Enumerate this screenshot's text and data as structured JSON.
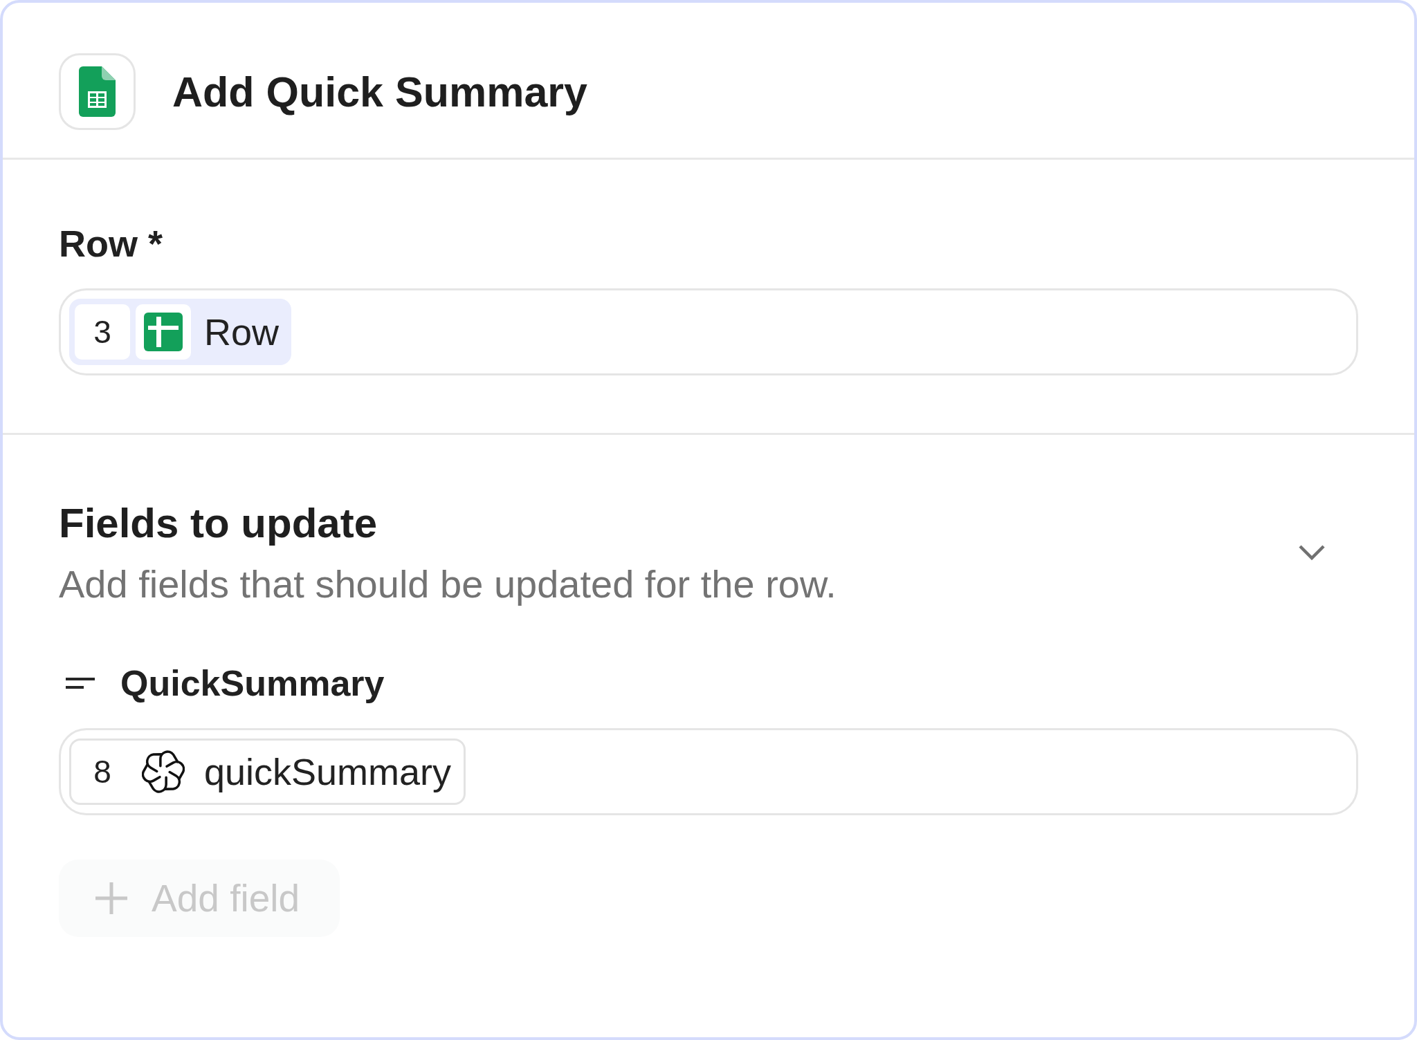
{
  "header": {
    "title": "Add Quick Summary"
  },
  "row_field": {
    "label": "Row *",
    "value": {
      "step": "3",
      "label": "Row",
      "kind": "sheets"
    }
  },
  "fields_section": {
    "title": "Fields to update",
    "description": "Add fields that should be updated for the row.",
    "fields": [
      {
        "label": "QuickSummary",
        "value": {
          "step": "8",
          "label": "quickSummary",
          "kind": "ai"
        }
      }
    ],
    "add_button": {
      "label": "Add field",
      "disabled": true
    }
  }
}
